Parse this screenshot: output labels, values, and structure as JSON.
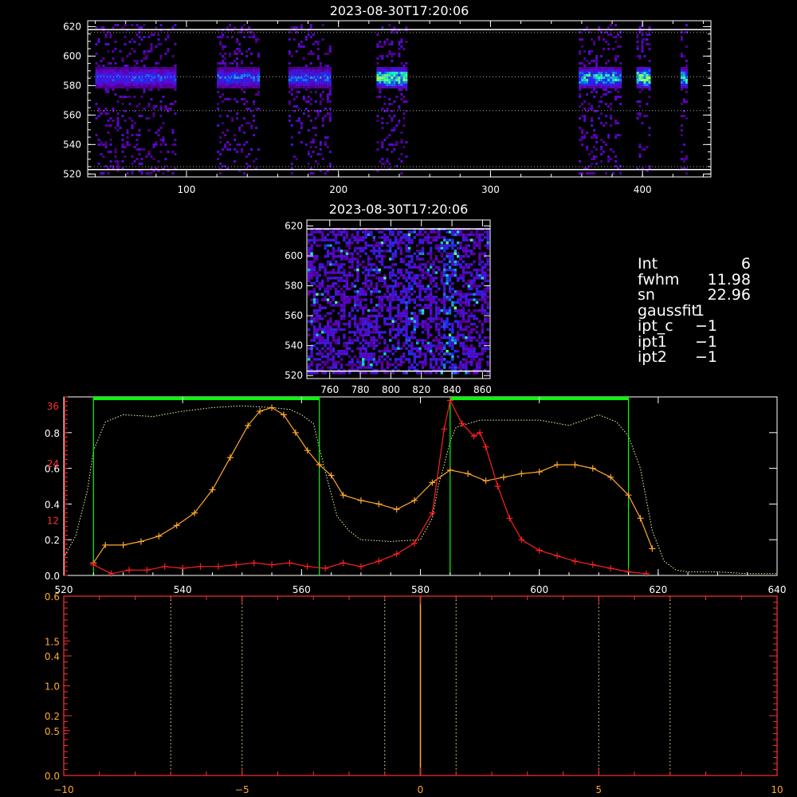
{
  "colors": {
    "background": "#000000",
    "axis": "#ffffff",
    "red_series": "#ff2020",
    "orange_series": "#ffa830",
    "filter_curve": "#e8ff9a",
    "window_green": "#00ff00",
    "bottom_axis": "#ff3030"
  },
  "info_panel": {
    "rows": [
      {
        "label": "Int",
        "value": "6"
      },
      {
        "label": "fwhm",
        "value": "11.98"
      },
      {
        "label": "sn",
        "value": "22.96"
      },
      {
        "label": "gaussfit",
        "value": "1"
      },
      {
        "label": "ipt_c",
        "value": "−1"
      },
      {
        "label": "ipt1",
        "value": "−1"
      },
      {
        "label": "ipt2",
        "value": "−1"
      }
    ]
  },
  "chart_data": [
    {
      "id": "top_image",
      "type": "heatmap",
      "title": "2023-08-30T17:20:06",
      "xlim": [
        35,
        445
      ],
      "ylim": [
        518,
        624
      ],
      "x_ticks": [
        "100",
        "200",
        "300",
        "400"
      ],
      "x_tick_values": [
        100,
        200,
        300,
        400
      ],
      "y_ticks": [
        "520",
        "540",
        "560",
        "580",
        "600",
        "620"
      ],
      "y_tick_values": [
        520,
        540,
        560,
        580,
        600,
        620
      ],
      "guide_lines": [
        616,
        586,
        563,
        525
      ],
      "bright_lines": [
        618,
        523
      ],
      "bands": [
        {
          "x0": 40,
          "x1": 92,
          "peak": 0.45
        },
        {
          "x0": 120,
          "x1": 147,
          "peak": 0.5
        },
        {
          "x0": 167,
          "x1": 195,
          "peak": 0.5
        },
        {
          "x0": 225,
          "x1": 245,
          "peak": 0.85
        },
        {
          "x0": 358,
          "x1": 386,
          "peak": 0.7
        },
        {
          "x0": 396,
          "x1": 405,
          "peak": 0.9
        },
        {
          "x0": 425,
          "x1": 429,
          "peak": 0.75
        }
      ]
    },
    {
      "id": "middle_image",
      "type": "heatmap",
      "title": "2023-08-30T17:20:06",
      "xlim": [
        745,
        865
      ],
      "ylim": [
        518,
        624
      ],
      "x_ticks": [
        "760",
        "780",
        "800",
        "820",
        "840",
        "860"
      ],
      "x_tick_values": [
        760,
        780,
        800,
        820,
        840,
        860
      ],
      "y_ticks": [
        "520",
        "540",
        "560",
        "580",
        "600",
        "620"
      ],
      "y_tick_values": [
        520,
        540,
        560,
        580,
        600,
        620
      ],
      "bright_lines": [
        618,
        523
      ]
    },
    {
      "id": "spectrum",
      "type": "line",
      "xlim": [
        520,
        640
      ],
      "ylim": [
        0,
        1.0
      ],
      "x_ticks": [
        "520",
        "540",
        "560",
        "580",
        "600",
        "620",
        "640"
      ],
      "x_tick_values": [
        520,
        540,
        560,
        580,
        600,
        620,
        640
      ],
      "y_ticks": [
        "0.0",
        "0.2",
        "0.4",
        "0.6",
        "0.8"
      ],
      "y_tick_values": [
        0.0,
        0.2,
        0.4,
        0.6,
        0.8
      ],
      "left_axis_labels": [
        {
          "text": "36",
          "value": 0.95
        },
        {
          "text": "24",
          "value": 0.63
        },
        {
          "text": "12",
          "value": 0.31
        }
      ],
      "windows": [
        [
          525,
          563
        ],
        [
          585,
          615
        ]
      ],
      "filter_curve": {
        "x": [
          520,
          522,
          524,
          525,
          527,
          530,
          535,
          540,
          545,
          550,
          555,
          558,
          560,
          562,
          564,
          566,
          568,
          570,
          575,
          580,
          582,
          583,
          584,
          585,
          586,
          588,
          590,
          595,
          600,
          605,
          610,
          613,
          615,
          617,
          619,
          621,
          623,
          625,
          630,
          635,
          640
        ],
        "y": [
          0.1,
          0.22,
          0.48,
          0.7,
          0.86,
          0.9,
          0.89,
          0.92,
          0.94,
          0.95,
          0.94,
          0.93,
          0.9,
          0.85,
          0.58,
          0.33,
          0.25,
          0.2,
          0.19,
          0.2,
          0.32,
          0.5,
          0.62,
          0.75,
          0.83,
          0.85,
          0.87,
          0.87,
          0.87,
          0.84,
          0.9,
          0.86,
          0.78,
          0.6,
          0.25,
          0.08,
          0.03,
          0.02,
          0.02,
          0.01,
          0.01
        ]
      },
      "series": [
        {
          "color": "#ffa830",
          "x": [
            525,
            527,
            530,
            533,
            536,
            539,
            542,
            545,
            548,
            551,
            553,
            555,
            557,
            559,
            561,
            563,
            565,
            567,
            570,
            573,
            576,
            579,
            582,
            585,
            588,
            591,
            594,
            597,
            600,
            603,
            606,
            609,
            612,
            615,
            617,
            619
          ],
          "y": [
            0.07,
            0.17,
            0.17,
            0.19,
            0.22,
            0.28,
            0.35,
            0.48,
            0.66,
            0.84,
            0.92,
            0.94,
            0.9,
            0.8,
            0.7,
            0.62,
            0.56,
            0.45,
            0.42,
            0.4,
            0.37,
            0.42,
            0.52,
            0.59,
            0.57,
            0.53,
            0.55,
            0.57,
            0.58,
            0.62,
            0.62,
            0.6,
            0.55,
            0.45,
            0.32,
            0.15
          ]
        },
        {
          "color": "#ff2020",
          "x": [
            525,
            528,
            531,
            534,
            537,
            540,
            543,
            546,
            549,
            552,
            555,
            558,
            561,
            564,
            567,
            570,
            573,
            576,
            579,
            582,
            584,
            585,
            587,
            589,
            590,
            591,
            593,
            595,
            597,
            600,
            603,
            606,
            609,
            612,
            615,
            618
          ],
          "y": [
            0.06,
            0.01,
            0.03,
            0.03,
            0.05,
            0.04,
            0.05,
            0.05,
            0.06,
            0.07,
            0.06,
            0.07,
            0.05,
            0.04,
            0.07,
            0.05,
            0.08,
            0.12,
            0.18,
            0.35,
            0.82,
            0.98,
            0.85,
            0.78,
            0.8,
            0.72,
            0.5,
            0.32,
            0.2,
            0.14,
            0.11,
            0.08,
            0.06,
            0.04,
            0.02,
            0.01
          ]
        }
      ]
    },
    {
      "id": "bottom_plot",
      "type": "line",
      "xlim": [
        -10,
        10
      ],
      "ylim": [
        0,
        0.6
      ],
      "x_ticks": [
        "−10",
        "−5",
        "0",
        "5",
        "10"
      ],
      "x_tick_values": [
        -10,
        -5,
        0,
        5,
        10
      ],
      "y_ticks": [
        "0.0",
        "0.2",
        "0.4",
        "0.6"
      ],
      "y_tick_values": [
        0.0,
        0.2,
        0.4,
        0.6
      ],
      "secondary_y_ticks": [
        "0.5",
        "1.0",
        "1.5"
      ],
      "secondary_y_tick_values": [
        0.5,
        1.0,
        1.5
      ],
      "secondary_ylim": [
        0,
        2.0
      ],
      "vlines_dotted": [
        -7,
        -5,
        -1,
        1,
        5,
        7
      ],
      "vline_solid": 0
    }
  ]
}
